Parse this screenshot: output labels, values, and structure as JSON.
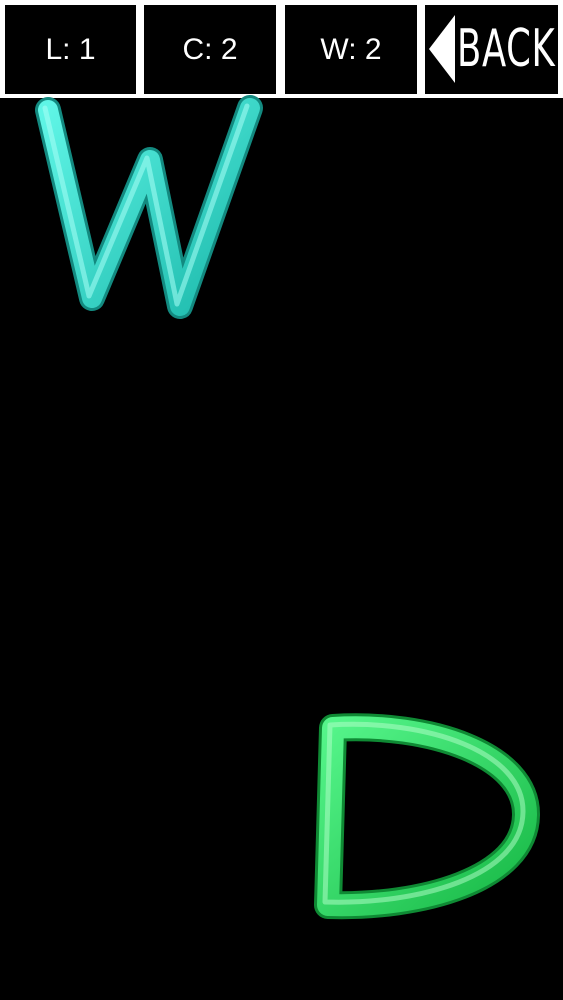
{
  "hud": {
    "level_label": "L: 1",
    "correct_label": "C: 2",
    "wrong_label": "W: 2",
    "back_label": "BACK"
  },
  "letters": [
    {
      "char": "W",
      "color": "#2fd9c8"
    },
    {
      "char": "D",
      "color": "#22e05a"
    }
  ],
  "colors": {
    "background": "#000000",
    "hud_border": "#ffffff",
    "hud_text": "#ffffff"
  }
}
